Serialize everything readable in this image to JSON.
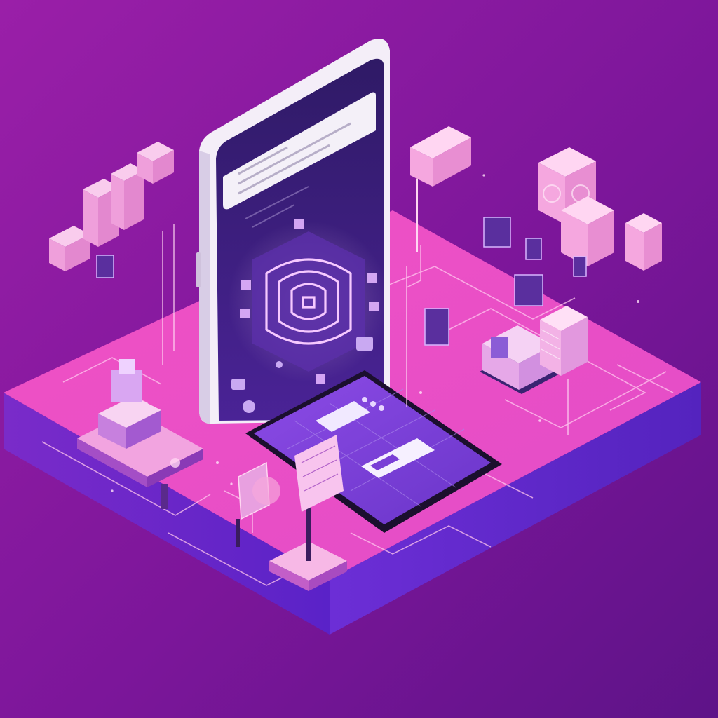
{
  "scene": {
    "subject": "isometric-smartphone-tech-illustration",
    "palette": {
      "background_top": "#8a1aa0",
      "background_bottom": "#6a1490",
      "platform_top": "#e64ec0",
      "platform_side": "#6a2bd8",
      "phone_frame": "#f3eef8",
      "phone_screen": "#3a1a72",
      "screen_panel": "#f2eef6",
      "glow_pink": "#ffb0e6",
      "cube_pink": "#f7a8dc",
      "tablet_purple": "#7a3fd6",
      "circuit_line": "#ffc6ee"
    },
    "icons": [
      "smartphone-icon",
      "fingerprint-icon",
      "tablet-icon",
      "server-stack-icon",
      "data-cube-icon",
      "desk-terminal-icon",
      "signpost-icon"
    ]
  }
}
